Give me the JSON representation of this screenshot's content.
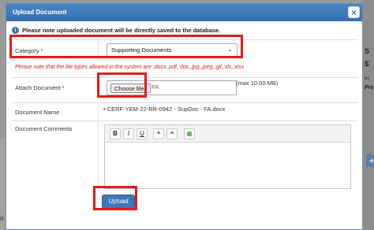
{
  "modal": {
    "title": "Upload Document",
    "close_label": "×",
    "notice": "Please note uploaded document will be directly saved to the database.",
    "notice_icon": "info-icon"
  },
  "form": {
    "category_label": "Category",
    "required_mark": "*",
    "category_value": "Supporting Documents",
    "filetype_note": "Please note that the file types allowed in the system are .docx,.pdf, doc,.jpg,.jpeg,.gif,.xls,.xlsx",
    "attach_label": "Attach Document",
    "choose_files_label": "Choose files",
    "file_selected_text": "FA",
    "max_size": "(max 10.00 MB)",
    "doc_name_label": "Document Name",
    "doc_name_value": "CERF-YEM-22-RR-0942 - SupDoc - FA.docx",
    "comments_label": "Document Comments",
    "toolbar": [
      "B",
      "I",
      "U",
      "ol",
      "ul",
      "more"
    ],
    "upload_label": "Upload"
  },
  "background": {
    "right_snippets": [
      "S",
      "$´",
      "ec",
      "Pre"
    ],
    "bottom_left": "ili"
  },
  "colors": {
    "header": "#3b75b5",
    "highlight": "#e01b1b",
    "required": "#cc0000",
    "upload_button": "#3c77b8"
  }
}
